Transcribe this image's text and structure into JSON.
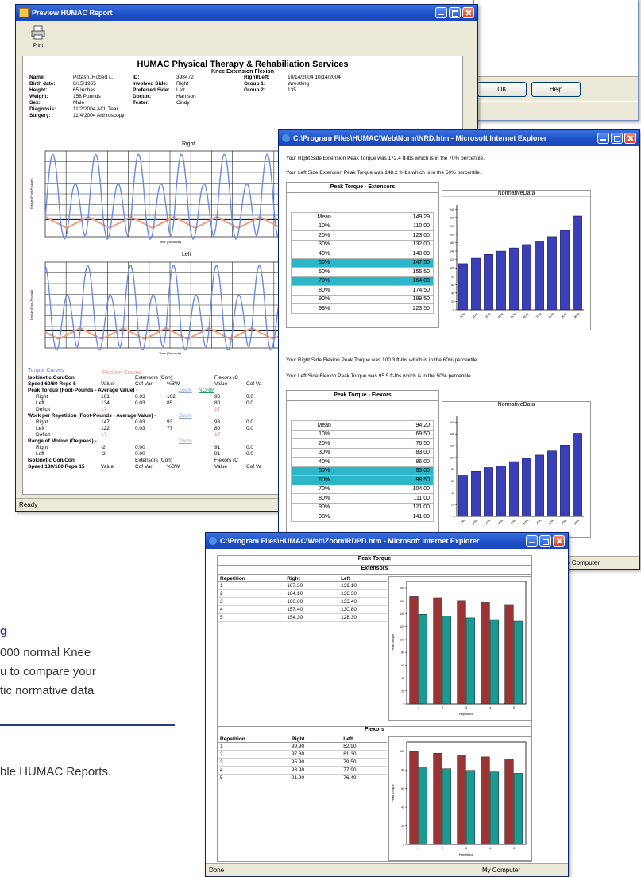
{
  "bg_window": {
    "ok_label": "OK",
    "help_label": "Help"
  },
  "preview": {
    "title": "Preview HUMAC Report",
    "print_label": "Print",
    "heading": "HUMAC Physical Therapy & Rehabiliation Services",
    "subheading": "Knee Extension Flexion",
    "patient": [
      {
        "label": "Name:",
        "value": "Potash, Robert L.",
        "label2": "ID:",
        "value2": "398472",
        "label3": "Right/Left:",
        "value3": "10/14/2004 10/14/2004"
      },
      {
        "label": "Birth date:",
        "value": "6/15/1965",
        "label2": "Involved Side:",
        "value2": "Right",
        "label3": "Group 1:",
        "value3": "Wrestling"
      },
      {
        "label": "Height:",
        "value": "65 Inches",
        "label2": "Preferred Side:",
        "value2": "Left",
        "label3": "Group 2:",
        "value3": "135"
      },
      {
        "label": "Weight:",
        "value": "158 Pounds",
        "label2": "Doctor:",
        "value2": "Harrison",
        "label3": "",
        "value3": ""
      },
      {
        "label": "Sex:",
        "value": "Male",
        "label2": "Tester:",
        "value2": "Cindy",
        "label3": "",
        "value3": ""
      },
      {
        "label": "Diagnosis:",
        "value": "11/2/2004 ACL Tear",
        "label2": "",
        "value2": "",
        "label3": "",
        "value3": ""
      },
      {
        "label": "Surgery:",
        "value": "11/4/2004 Arthroscopy",
        "label2": "",
        "value2": "",
        "label3": "",
        "value3": ""
      }
    ],
    "graph_right_title": "Right",
    "graph_left_title": "Left",
    "y_axis_label": "Torque (Foot-Pounds)",
    "x_axis_label": "Time (Seconds)",
    "legend_torque": "Torque Curves",
    "legend_position": "Position Curves",
    "report_rows": [
      [
        "Isokinetic Con/Con",
        "",
        "Extensors (Con)",
        "",
        "Flexors (C"
      ],
      [
        "Speed 60/60 Reps 5",
        "Value",
        "Cof Var",
        "%BW",
        "Value",
        "Cof Va"
      ],
      [
        "Peak Torque (Foot-Pounds - Average Value) -",
        "Zoom",
        "NORM"
      ],
      [
        "Right",
        "161",
        "0.03",
        "102",
        "96",
        "0.0"
      ],
      [
        "Left",
        "134",
        "0.03",
        "85",
        "80",
        "0.0"
      ],
      [
        "Deficit",
        "17",
        "",
        "",
        "17",
        ""
      ],
      [
        "Work per Repetition (Foot-Pounds - Average Value) -",
        "Zoom"
      ],
      [
        "Right",
        "147",
        "0.03",
        "93",
        "96",
        "0.0"
      ],
      [
        "Left",
        "122",
        "0.03",
        "77",
        "80",
        "0.0"
      ],
      [
        "Deficit",
        "17",
        "",
        "",
        "17",
        ""
      ],
      [
        "Range of Motion (Degrees) -",
        "Zoom"
      ],
      [
        "Right",
        "-2",
        "0.00",
        "",
        "91",
        "0.0"
      ],
      [
        "Left",
        "-2",
        "0.00",
        "",
        "91",
        "0.0"
      ],
      [
        "Isokinetic Con/Con",
        "",
        "Extensors (Con)",
        "",
        "Flexors (C"
      ],
      [
        "Speed 180/180 Reps 15",
        "Value",
        "Cof Var",
        "%BW",
        "Value",
        "Cof Va"
      ]
    ],
    "status": "Ready"
  },
  "norm": {
    "title": "C:\\Program Files\\HUMAC\\Web\\Norm\\NRD.htm - Microsoft Internet Explorer",
    "ext_line1": "Your Right Side Extension Peak Torque was 172.4 ft-lbs which is in the 70% percentile.",
    "ext_line2": "Your Left Side Extension Peak Torque was 148.2 ft-lbs which is in the 50% percentile.",
    "ext_table_title": "Peak Torque - Extensors",
    "ext_rows": [
      [
        "Mean",
        "149.29"
      ],
      [
        "10%",
        "110.00"
      ],
      [
        "20%",
        "123.00"
      ],
      [
        "30%",
        "132.00"
      ],
      [
        "40%",
        "140.00"
      ],
      [
        "50%",
        "147.50"
      ],
      [
        "60%",
        "155.50"
      ],
      [
        "70%",
        "164.00"
      ],
      [
        "80%",
        "174.50"
      ],
      [
        "90%",
        "189.50"
      ],
      [
        "98%",
        "223.50"
      ]
    ],
    "ext_chart_title": "NormativeData",
    "flex_line1": "Your Right Side Flexion Peak Torque was 100.3 ft-lbs which is in the 60% percentile.",
    "flex_line2": "Your Left Side Flexion Peak Torque was 95.5 ft-lbs which is in the 50% percentile.",
    "flex_table_title": "Peak Torque - Flexors",
    "flex_rows": [
      [
        "Mean",
        "94.20"
      ],
      [
        "10%",
        "69.50"
      ],
      [
        "20%",
        "76.50"
      ],
      [
        "30%",
        "83.00"
      ],
      [
        "40%",
        "86.00"
      ],
      [
        "50%",
        "93.00"
      ],
      [
        "60%",
        "98.50"
      ],
      [
        "70%",
        "104.00"
      ],
      [
        "80%",
        "111.00"
      ],
      [
        "90%",
        "121.00"
      ],
      [
        "98%",
        "141.00"
      ]
    ],
    "flex_chart_title": "NormativeData",
    "status_right": "My Computer"
  },
  "rep": {
    "title": "C:\\Program Files\\HUMAC\\Web\\Zoom\\RDPD.htm - Microsoft Internet Explorer",
    "main_title": "Peak Torque",
    "ext_title": "Extensors",
    "flex_title": "Flexors",
    "headers": [
      "Repetition",
      "Right",
      "Left"
    ],
    "ext_rows": [
      [
        "1",
        "167.30",
        "139.10"
      ],
      [
        "2",
        "164.10",
        "136.30"
      ],
      [
        "3",
        "160.60",
        "133.40"
      ],
      [
        "4",
        "157.40",
        "130.80"
      ],
      [
        "5",
        "154.30",
        "128.30"
      ]
    ],
    "flex_rows": [
      [
        "1",
        "99.90",
        "82.90"
      ],
      [
        "2",
        "97.80",
        "81.30"
      ],
      [
        "3",
        "95.90",
        "79.50"
      ],
      [
        "4",
        "93.90",
        "77.90"
      ],
      [
        "5",
        "91.90",
        "76.40"
      ]
    ],
    "y_label": "Peak Torque",
    "x_label": "Repetition",
    "status_left": "Done",
    "status_right": "My Computer"
  },
  "page_text": {
    "heading_fragment": "g",
    "para_line1": "000 normal Knee",
    "para_line2": "u to compare your",
    "para_line3": "tic normative data",
    "bottom_line": "ble HUMAC Reports."
  },
  "colors": {
    "accent": "#2a3c8a",
    "norm_bar": "#3a3fb8",
    "right_bar": "#9b3434",
    "left_bar": "#1a9a90",
    "highlight": "#2cb6c8"
  },
  "chart_data": [
    {
      "type": "bar",
      "categories": [
        "10%",
        "20%",
        "30%",
        "40%",
        "50%",
        "60%",
        "70%",
        "80%",
        "90%",
        "98%"
      ],
      "series": [
        {
          "values": [
            110,
            123,
            132,
            140,
            147.5,
            155.5,
            164,
            174.5,
            189.5,
            223.5
          ]
        }
      ],
      "title": "NormativeData"
    },
    {
      "type": "bar",
      "categories": [
        "10%",
        "20%",
        "30%",
        "40%",
        "50%",
        "60%",
        "70%",
        "80%",
        "90%",
        "98%"
      ],
      "series": [
        {
          "values": [
            69.5,
            76.5,
            83,
            86,
            93,
            98.5,
            104,
            111,
            121,
            141
          ]
        }
      ],
      "title": "NormativeData"
    },
    {
      "type": "bar",
      "categories": [
        "1",
        "2",
        "3",
        "4",
        "5"
      ],
      "series": [
        {
          "name": "Right",
          "values": [
            167.3,
            164.1,
            160.6,
            157.4,
            154.3
          ]
        },
        {
          "name": "Left",
          "values": [
            139.1,
            136.3,
            133.4,
            130.8,
            128.3
          ]
        }
      ],
      "ylabel": "Peak Torque",
      "xlabel": "Repetition"
    },
    {
      "type": "bar",
      "categories": [
        "1",
        "2",
        "3",
        "4",
        "5"
      ],
      "series": [
        {
          "name": "Right",
          "values": [
            99.9,
            97.8,
            95.9,
            93.9,
            91.9
          ]
        },
        {
          "name": "Left",
          "values": [
            82.9,
            81.3,
            79.5,
            77.9,
            76.4
          ]
        }
      ],
      "ylabel": "Peak Torque",
      "xlabel": "Repetition"
    }
  ]
}
